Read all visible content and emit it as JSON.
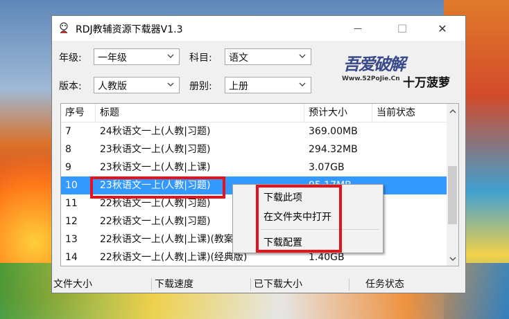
{
  "window": {
    "title": "RDJ教辅资源下载器V1.3",
    "controls": {
      "minimize": "—",
      "maximize": "☐",
      "close": "✕"
    }
  },
  "filters": {
    "grade_label": "年级:",
    "grade_value": "一年级",
    "subject_label": "科目:",
    "subject_value": "语文",
    "edition_label": "版本:",
    "edition_value": "人教版",
    "volume_label": "册别:",
    "volume_value": "上册"
  },
  "logo": {
    "main": "吾爱破解",
    "url": "Www.52PoJie.Cn",
    "tag": "十万菠萝"
  },
  "list": {
    "columns": [
      "序号",
      "标题",
      "预计大小",
      "当前状态"
    ],
    "rows": [
      {
        "id": "7",
        "title": "24秋语文一上(人教|习题)",
        "size": "369.00MB",
        "status": ""
      },
      {
        "id": "8",
        "title": "23秋语文一上(人教|习题)",
        "size": "294.32MB",
        "status": ""
      },
      {
        "id": "9",
        "title": "23秋语文一上(人教|上课)",
        "size": "3.07GB",
        "status": ""
      },
      {
        "id": "10",
        "title": "23秋语文一上(人教|习题)",
        "size": "95.17MB",
        "status": "",
        "selected": true
      },
      {
        "id": "11",
        "title": "22秋语文一上(人教|习题)",
        "size": "",
        "status": ""
      },
      {
        "id": "12",
        "title": "22秋语文一上(人教|习题)",
        "size": "",
        "status": ""
      },
      {
        "id": "13",
        "title": "22秋语文一上(人教|上课)(教案",
        "size": "",
        "status": ""
      },
      {
        "id": "14",
        "title": "22秋语文一上(人教|上课)(经典版)",
        "size": "1.40GB",
        "status": ""
      }
    ]
  },
  "context_menu": {
    "items": [
      "下载此项",
      "在文件夹中打开",
      "下载配置"
    ]
  },
  "statusbar": {
    "file_size": "文件大小",
    "download_speed": "下载速度",
    "downloaded_size": "已下载大小",
    "task_status": "任务状态"
  },
  "colors": {
    "selection": "#3399ff",
    "highlight_box": "#e8101a"
  }
}
